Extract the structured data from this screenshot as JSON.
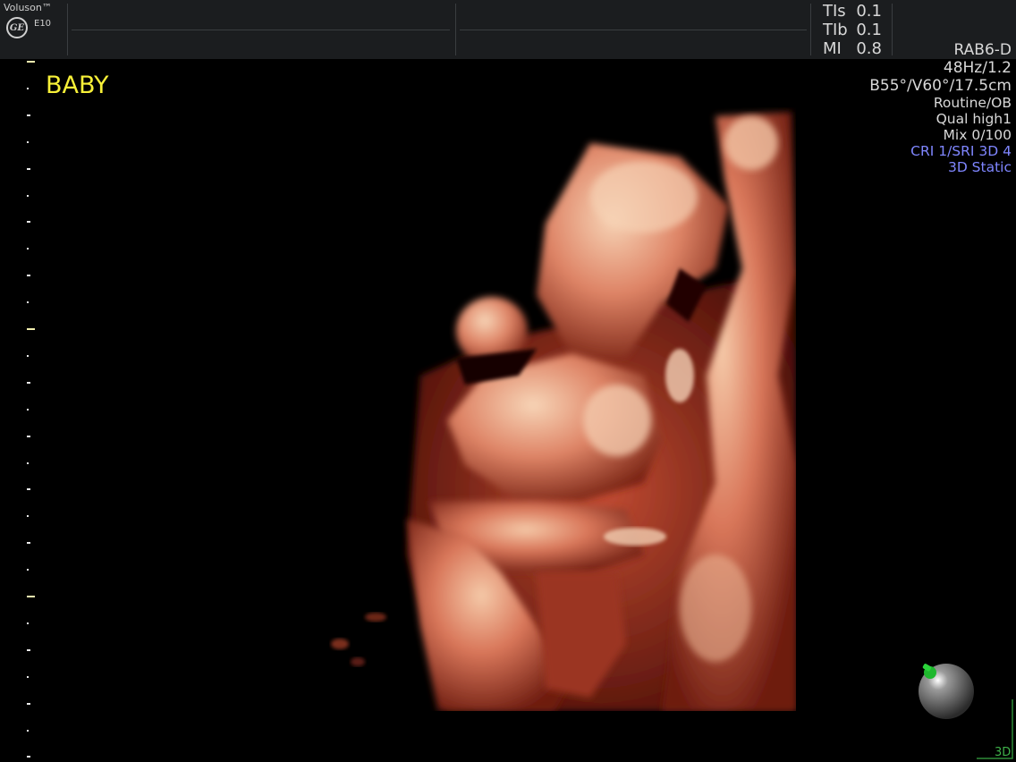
{
  "header": {
    "brand": "Voluson™",
    "logo": "GE",
    "model": "E10",
    "indices": [
      {
        "label": "TIs",
        "value": "0.1"
      },
      {
        "label": "TIb",
        "value": "0.1"
      },
      {
        "label": "MI",
        "value": "0.8"
      }
    ]
  },
  "info_panel": {
    "probe": "RAB6-D",
    "frequency": "48Hz/1.2",
    "angles": "B55°/V60°/17.5cm",
    "preset": "Routine/OB",
    "quality": "Qual high1",
    "mix": "Mix 0/100",
    "cri": "CRI 1/SRI 3D 4",
    "mode": "3D Static"
  },
  "annotation": "BABY",
  "mode_indicator": "3D",
  "icons": {
    "logo": "ge-logo-icon",
    "orientation": "orientation-sphere-icon"
  },
  "colors": {
    "annotation": "#f7f038",
    "info_blue": "#7f86ff",
    "mode_green": "#3fb24a",
    "tissue": "#c9583a"
  }
}
